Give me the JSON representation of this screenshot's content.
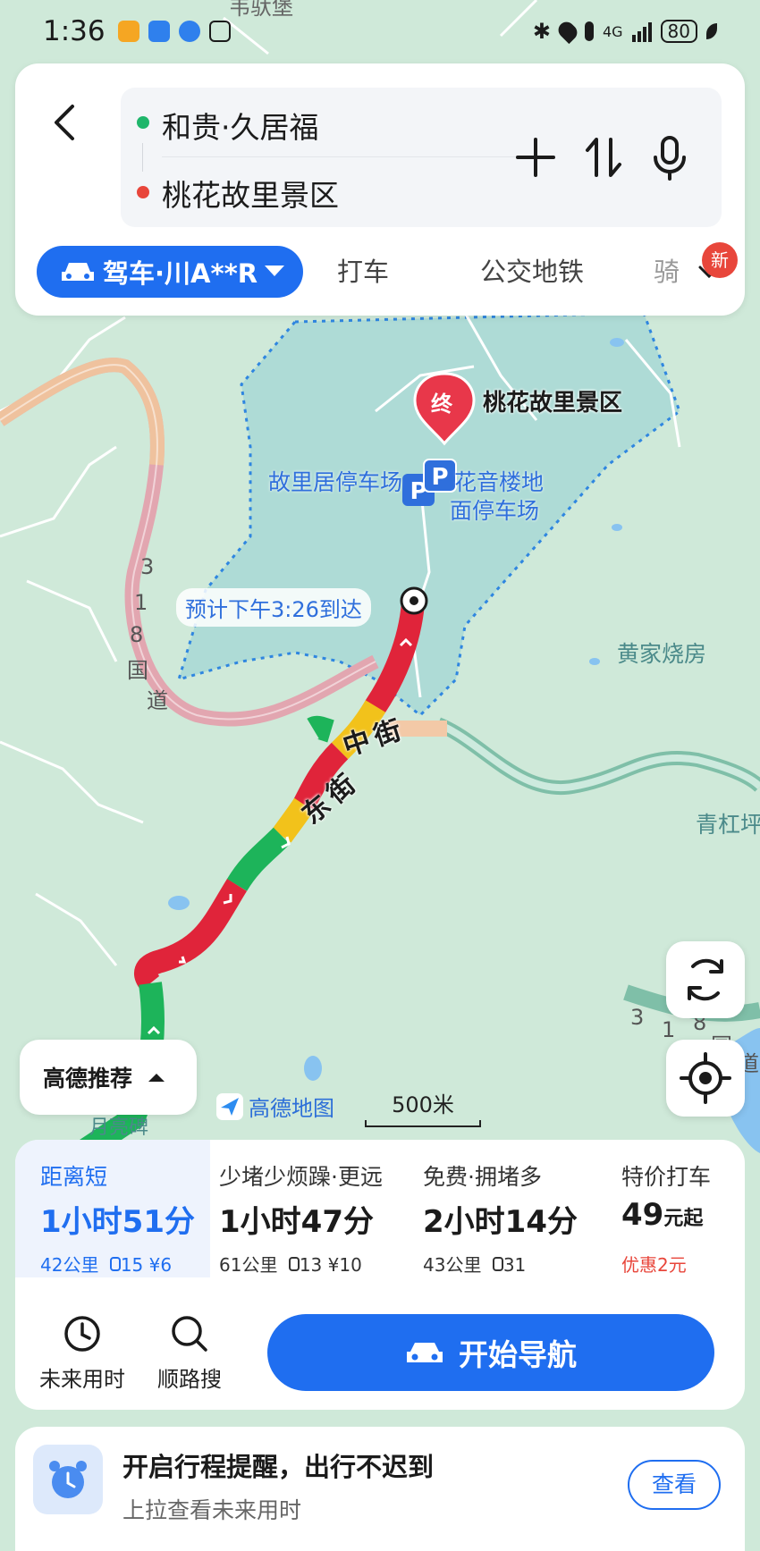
{
  "status_bar": {
    "time": "1:36",
    "network": "4G",
    "battery": "80",
    "icons": [
      "app-icon",
      "audio-icon",
      "message-icon",
      "nfc-icon",
      "bluetooth-icon",
      "location-icon",
      "mic-icon",
      "signal-icon"
    ]
  },
  "search": {
    "origin": "和贵·久居福",
    "destination": "桃花故里景区",
    "origin_color": "#1fb66b",
    "destination_color": "#e8463b"
  },
  "mode_tabs": {
    "active": "驾车·川A**R",
    "items": [
      "打车",
      "公交地铁",
      "骑"
    ],
    "new_badge": "新"
  },
  "map": {
    "destination_marker": "终",
    "destination_label": "桃花故里景区",
    "parking_1": "故里居停车场",
    "parking_2_line1": "花音楼地",
    "parking_2_line2": "面停车场",
    "eta_label": "预计下午3:26到达",
    "road_national_chars": [
      "3",
      "1",
      "8",
      "国",
      "道"
    ],
    "road_national_right_chars": [
      "3",
      "1",
      "8",
      "国",
      "道"
    ],
    "street_middle": "中街",
    "street_east": "东街",
    "place_huangjia": "黄家烧房",
    "place_qinggang": "青杠坪",
    "place_top": "韦驮堡",
    "place_bottom": "月亮碑",
    "brand": "高德地图",
    "scale": "500米",
    "accent": "#1f6ef0",
    "traffic_colors": {
      "smooth": "#1db45a",
      "slow": "#f2c21b",
      "jam": "#e0243a"
    }
  },
  "recommend": "高德推荐",
  "routes": [
    {
      "label": "距离短",
      "time": "1小时51分",
      "distance": "42公里",
      "lights": "15",
      "toll": "¥6",
      "selected": true
    },
    {
      "label": "少堵少烦躁·更远",
      "time": "1小时47分",
      "distance": "61公里",
      "lights": "13",
      "toll": "¥10",
      "selected": false
    },
    {
      "label": "免费·拥堵多",
      "time": "2小时14分",
      "distance": "43公里",
      "lights": "31",
      "toll": "",
      "selected": false
    },
    {
      "label": "特价打车",
      "price": "49",
      "price_unit": "元起",
      "promo": "优惠2元",
      "selected": false
    }
  ],
  "actions": {
    "future_time": "未来用时",
    "along_search": "顺路搜",
    "start_nav": "开始导航"
  },
  "reminder": {
    "title": "开启行程提醒，出行不迟到",
    "desc": "上拉查看未来用时",
    "button": "查看"
  }
}
